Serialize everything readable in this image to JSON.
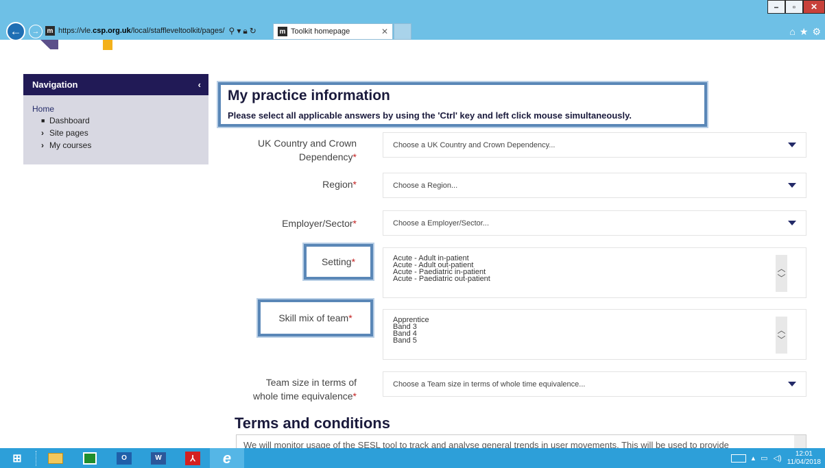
{
  "browser": {
    "url_prefix": "https://vle.",
    "url_domain": "csp.org.uk",
    "url_rest": "/local/staffleveltoolkit/pages/",
    "tab_title": "Toolkit homepage",
    "favicon_letter": "m"
  },
  "navigation": {
    "title": "Navigation",
    "collapse_icon": "chevron-left",
    "home": "Home",
    "items": [
      {
        "label": "Dashboard",
        "icon": "square-bullet"
      },
      {
        "label": "Site pages",
        "icon": "chevron-right"
      },
      {
        "label": "My courses",
        "icon": "chevron-right"
      }
    ]
  },
  "heading": {
    "title": "My practice information",
    "instruction": "Please select all applicable answers by using the 'Ctrl' key and left click mouse simultaneously."
  },
  "form": {
    "country": {
      "label_line1": "UK Country and Crown",
      "label_line2": "Dependency",
      "required": "*",
      "placeholder": "Choose a UK Country and Crown Dependency..."
    },
    "region": {
      "label": "Region",
      "required": "*",
      "placeholder": "Choose a Region..."
    },
    "employer": {
      "label": "Employer/Sector",
      "required": "*",
      "placeholder": "Choose a Employer/Sector..."
    },
    "setting": {
      "label": "Setting",
      "required": "*",
      "options": [
        "Acute - Adult in-patient",
        "Acute - Adult out-patient",
        "Acute - Paediatric in-patient",
        "Acute - Paediatric out-patient"
      ]
    },
    "skillmix": {
      "label": "Skill mix of team",
      "required": "*",
      "options": [
        "Apprentice",
        "Band 3",
        "Band 4",
        "Band 5"
      ]
    },
    "teamsize": {
      "label_line1": "Team size in terms of",
      "label_line2": "whole time equivalence",
      "required": "*",
      "placeholder": "Choose a Team size in terms of whole time equivalence..."
    }
  },
  "terms": {
    "title": "Terms and conditions",
    "text": "We will monitor usage of the SESL tool to track and analyse general trends in user movements. This will be used to provide"
  },
  "taskbar": {
    "time": "12:01",
    "date": "11/04/2018"
  },
  "colors": {
    "nav_header": "#211a56",
    "highlight_border": "#5a87b7",
    "required": "#c32222",
    "taskbar": "#2d9fd9",
    "browser_chrome": "#6ec0e6"
  }
}
